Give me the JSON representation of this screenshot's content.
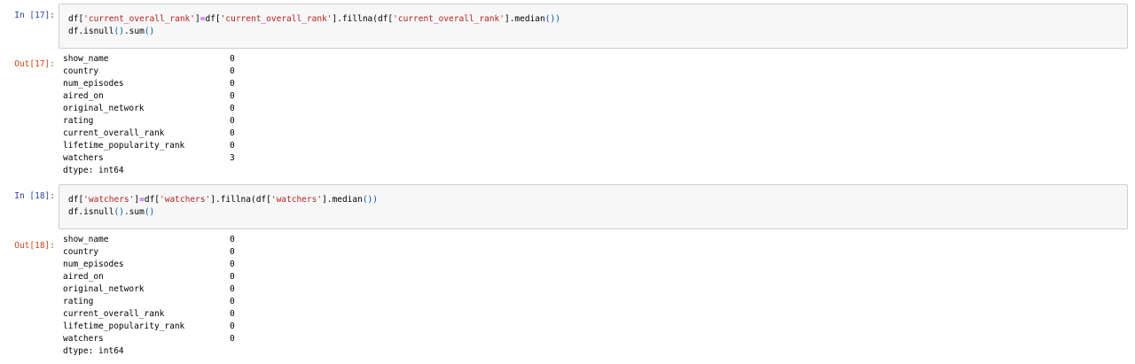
{
  "cells": [
    {
      "in_prompt": "In [17]:",
      "out_prompt": "Out[17]:",
      "code": {
        "line1": {
          "a": "df[",
          "s1": "'current_overall_rank'",
          "b": "]",
          "eq": "=",
          "c": "df[",
          "s2": "'current_overall_rank'",
          "d": "].fillna(df[",
          "s3": "'current_overall_rank'",
          "e": "].median",
          "p": "())"
        },
        "line2": {
          "a": "df.isnull",
          "p1": "()",
          "b": ".sum",
          "p2": "()"
        }
      },
      "output": [
        {
          "key": "show_name",
          "value": "0"
        },
        {
          "key": "country",
          "value": "0"
        },
        {
          "key": "num_episodes",
          "value": "0"
        },
        {
          "key": "aired_on",
          "value": "0"
        },
        {
          "key": "original_network",
          "value": "0"
        },
        {
          "key": "rating",
          "value": "0"
        },
        {
          "key": "current_overall_rank",
          "value": "0"
        },
        {
          "key": "lifetime_popularity_rank",
          "value": "0"
        },
        {
          "key": "watchers",
          "value": "3"
        }
      ],
      "dtype": "dtype: int64"
    },
    {
      "in_prompt": "In [18]:",
      "out_prompt": "Out[18]:",
      "code": {
        "line1": {
          "a": "df[",
          "s1": "'watchers'",
          "b": "]",
          "eq": "=",
          "c": "df[",
          "s2": "'watchers'",
          "d": "].fillna(df[",
          "s3": "'watchers'",
          "e": "].median",
          "p": "())"
        },
        "line2": {
          "a": "df.isnull",
          "p1": "()",
          "b": ".sum",
          "p2": "()"
        }
      },
      "output": [
        {
          "key": "show_name",
          "value": "0"
        },
        {
          "key": "country",
          "value": "0"
        },
        {
          "key": "num_episodes",
          "value": "0"
        },
        {
          "key": "aired_on",
          "value": "0"
        },
        {
          "key": "original_network",
          "value": "0"
        },
        {
          "key": "rating",
          "value": "0"
        },
        {
          "key": "current_overall_rank",
          "value": "0"
        },
        {
          "key": "lifetime_popularity_rank",
          "value": "0"
        },
        {
          "key": "watchers",
          "value": "0"
        }
      ],
      "dtype": "dtype: int64"
    }
  ]
}
